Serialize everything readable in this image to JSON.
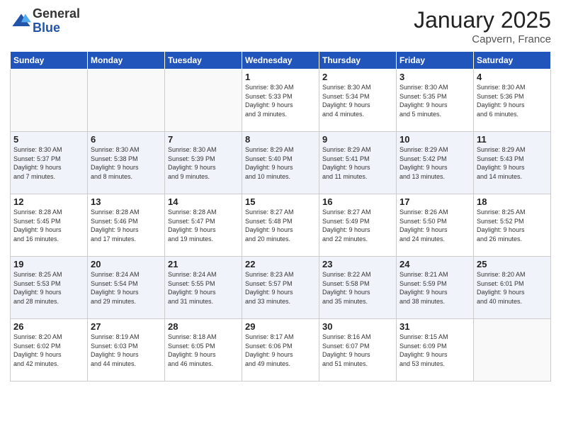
{
  "logo": {
    "general": "General",
    "blue": "Blue"
  },
  "header": {
    "month": "January 2025",
    "location": "Capvern, France"
  },
  "weekdays": [
    "Sunday",
    "Monday",
    "Tuesday",
    "Wednesday",
    "Thursday",
    "Friday",
    "Saturday"
  ],
  "weeks": [
    [
      {
        "day": "",
        "info": ""
      },
      {
        "day": "",
        "info": ""
      },
      {
        "day": "",
        "info": ""
      },
      {
        "day": "1",
        "info": "Sunrise: 8:30 AM\nSunset: 5:33 PM\nDaylight: 9 hours\nand 3 minutes."
      },
      {
        "day": "2",
        "info": "Sunrise: 8:30 AM\nSunset: 5:34 PM\nDaylight: 9 hours\nand 4 minutes."
      },
      {
        "day": "3",
        "info": "Sunrise: 8:30 AM\nSunset: 5:35 PM\nDaylight: 9 hours\nand 5 minutes."
      },
      {
        "day": "4",
        "info": "Sunrise: 8:30 AM\nSunset: 5:36 PM\nDaylight: 9 hours\nand 6 minutes."
      }
    ],
    [
      {
        "day": "5",
        "info": "Sunrise: 8:30 AM\nSunset: 5:37 PM\nDaylight: 9 hours\nand 7 minutes."
      },
      {
        "day": "6",
        "info": "Sunrise: 8:30 AM\nSunset: 5:38 PM\nDaylight: 9 hours\nand 8 minutes."
      },
      {
        "day": "7",
        "info": "Sunrise: 8:30 AM\nSunset: 5:39 PM\nDaylight: 9 hours\nand 9 minutes."
      },
      {
        "day": "8",
        "info": "Sunrise: 8:29 AM\nSunset: 5:40 PM\nDaylight: 9 hours\nand 10 minutes."
      },
      {
        "day": "9",
        "info": "Sunrise: 8:29 AM\nSunset: 5:41 PM\nDaylight: 9 hours\nand 11 minutes."
      },
      {
        "day": "10",
        "info": "Sunrise: 8:29 AM\nSunset: 5:42 PM\nDaylight: 9 hours\nand 13 minutes."
      },
      {
        "day": "11",
        "info": "Sunrise: 8:29 AM\nSunset: 5:43 PM\nDaylight: 9 hours\nand 14 minutes."
      }
    ],
    [
      {
        "day": "12",
        "info": "Sunrise: 8:28 AM\nSunset: 5:45 PM\nDaylight: 9 hours\nand 16 minutes."
      },
      {
        "day": "13",
        "info": "Sunrise: 8:28 AM\nSunset: 5:46 PM\nDaylight: 9 hours\nand 17 minutes."
      },
      {
        "day": "14",
        "info": "Sunrise: 8:28 AM\nSunset: 5:47 PM\nDaylight: 9 hours\nand 19 minutes."
      },
      {
        "day": "15",
        "info": "Sunrise: 8:27 AM\nSunset: 5:48 PM\nDaylight: 9 hours\nand 20 minutes."
      },
      {
        "day": "16",
        "info": "Sunrise: 8:27 AM\nSunset: 5:49 PM\nDaylight: 9 hours\nand 22 minutes."
      },
      {
        "day": "17",
        "info": "Sunrise: 8:26 AM\nSunset: 5:50 PM\nDaylight: 9 hours\nand 24 minutes."
      },
      {
        "day": "18",
        "info": "Sunrise: 8:25 AM\nSunset: 5:52 PM\nDaylight: 9 hours\nand 26 minutes."
      }
    ],
    [
      {
        "day": "19",
        "info": "Sunrise: 8:25 AM\nSunset: 5:53 PM\nDaylight: 9 hours\nand 28 minutes."
      },
      {
        "day": "20",
        "info": "Sunrise: 8:24 AM\nSunset: 5:54 PM\nDaylight: 9 hours\nand 29 minutes."
      },
      {
        "day": "21",
        "info": "Sunrise: 8:24 AM\nSunset: 5:55 PM\nDaylight: 9 hours\nand 31 minutes."
      },
      {
        "day": "22",
        "info": "Sunrise: 8:23 AM\nSunset: 5:57 PM\nDaylight: 9 hours\nand 33 minutes."
      },
      {
        "day": "23",
        "info": "Sunrise: 8:22 AM\nSunset: 5:58 PM\nDaylight: 9 hours\nand 35 minutes."
      },
      {
        "day": "24",
        "info": "Sunrise: 8:21 AM\nSunset: 5:59 PM\nDaylight: 9 hours\nand 38 minutes."
      },
      {
        "day": "25",
        "info": "Sunrise: 8:20 AM\nSunset: 6:01 PM\nDaylight: 9 hours\nand 40 minutes."
      }
    ],
    [
      {
        "day": "26",
        "info": "Sunrise: 8:20 AM\nSunset: 6:02 PM\nDaylight: 9 hours\nand 42 minutes."
      },
      {
        "day": "27",
        "info": "Sunrise: 8:19 AM\nSunset: 6:03 PM\nDaylight: 9 hours\nand 44 minutes."
      },
      {
        "day": "28",
        "info": "Sunrise: 8:18 AM\nSunset: 6:05 PM\nDaylight: 9 hours\nand 46 minutes."
      },
      {
        "day": "29",
        "info": "Sunrise: 8:17 AM\nSunset: 6:06 PM\nDaylight: 9 hours\nand 49 minutes."
      },
      {
        "day": "30",
        "info": "Sunrise: 8:16 AM\nSunset: 6:07 PM\nDaylight: 9 hours\nand 51 minutes."
      },
      {
        "day": "31",
        "info": "Sunrise: 8:15 AM\nSunset: 6:09 PM\nDaylight: 9 hours\nand 53 minutes."
      },
      {
        "day": "",
        "info": ""
      }
    ]
  ]
}
